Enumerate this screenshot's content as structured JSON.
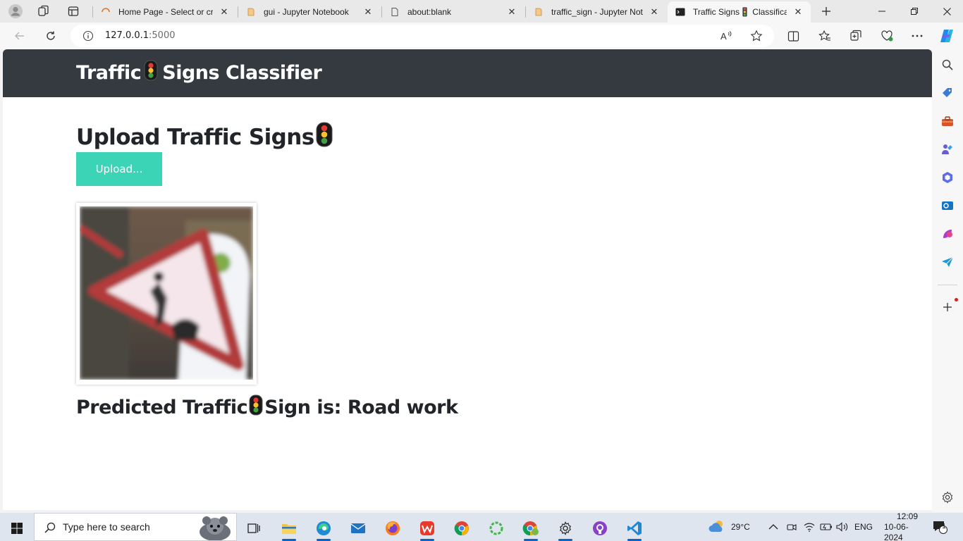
{
  "browser": {
    "tabs": [
      {
        "title": "Home Page - Select or cre",
        "icon": "loading-spinner-icon",
        "active": false
      },
      {
        "title": "gui - Jupyter Notebook",
        "icon": "jupyter-icon",
        "active": false
      },
      {
        "title": "about:blank",
        "icon": "page-icon",
        "active": false
      },
      {
        "title": "traffic_sign - Jupyter Note",
        "icon": "jupyter-icon",
        "active": false
      },
      {
        "title": "Traffic Signs🚦 Classificatio",
        "icon": "terminal-icon",
        "active": true
      }
    ],
    "address": {
      "host": "127.0.0.1",
      "port": ":5000"
    }
  },
  "page": {
    "brand_left": "Traffic",
    "brand_right": "Signs Classifier",
    "upload_heading": "Upload Traffic Signs",
    "upload_button": "Upload...",
    "prediction_prefix": "Predicted Traffic",
    "prediction_suffix": "Sign is: Road work",
    "emoji": "traffic-light"
  },
  "taskbar": {
    "search_placeholder": "Type here to search",
    "weather": "29°C",
    "language": "ENG",
    "time": "12:09",
    "date": "10-06-2024",
    "notifications": "1"
  },
  "colors": {
    "navbar": "#343a40",
    "upload_button": "#3bd4b6",
    "heading_text": "#212529"
  }
}
